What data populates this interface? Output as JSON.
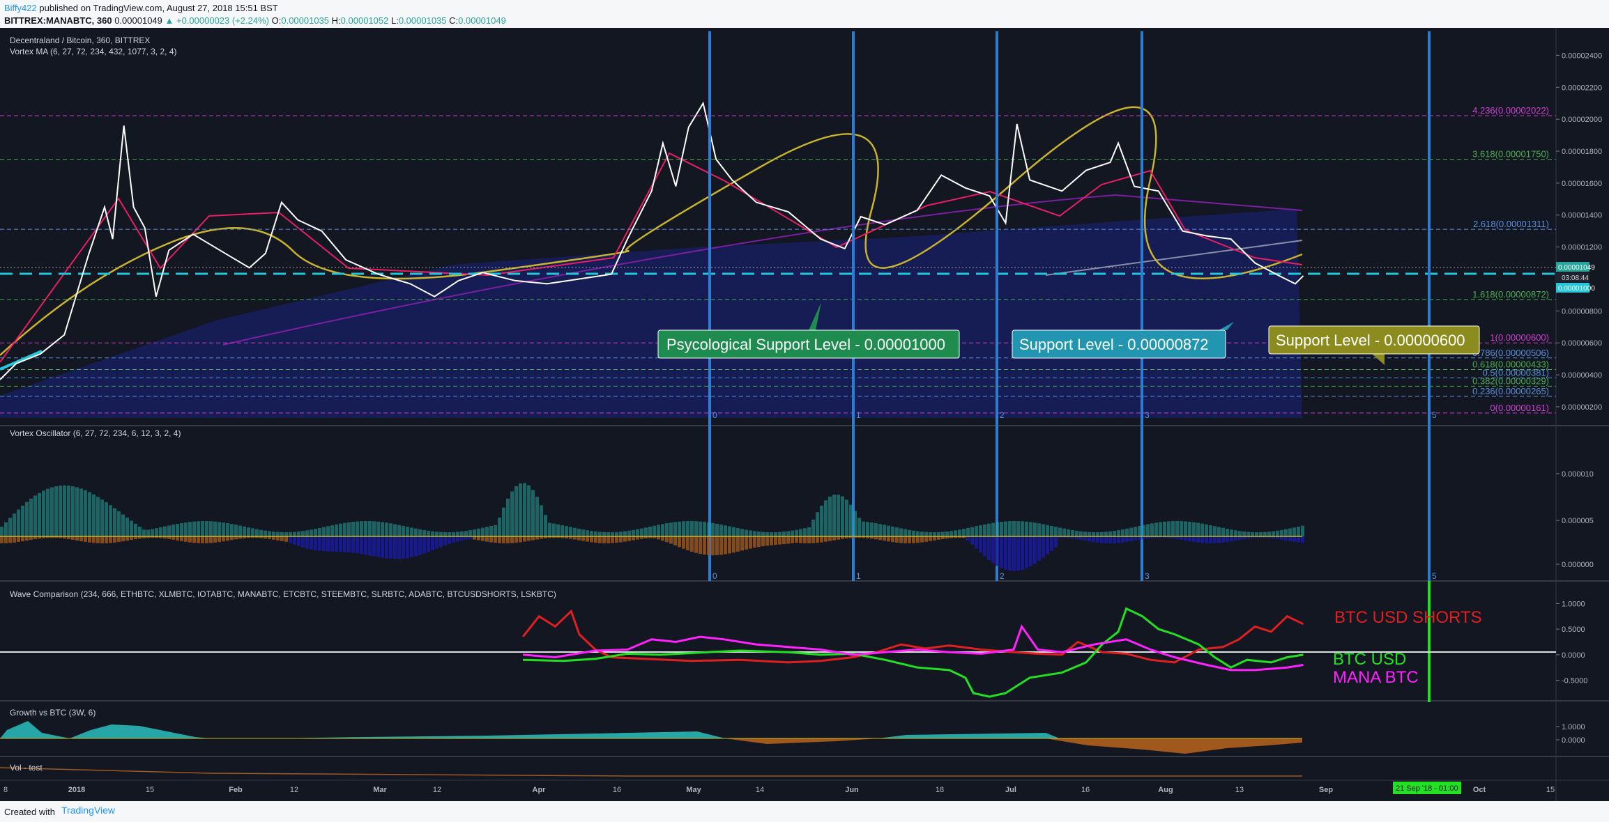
{
  "header": {
    "author": "Biffy422",
    "published": "published on TradingView.com, August 27, 2018 15:51 BST",
    "symbol": "BITTREX:MANABTC, 360",
    "last": "0.00001049",
    "change": "▲ +0.00000023 (+2.24%)",
    "o_label": "O:",
    "o": "0.00001035",
    "h_label": "H:",
    "h": "0.00001052",
    "l_label": "L:",
    "l": "0.00001035",
    "c_label": "C:",
    "c": "0.00001049"
  },
  "panes": {
    "main_title": "Decentraland / Bitcoin, 360, BITTREX",
    "main_indicator": "Vortex MA (6, 27, 72, 234, 432, 1077, 3, 2, 4)",
    "oscillator": "Vortex Oscillator (6, 27, 72, 234, 6, 12, 3, 2, 4)",
    "wave": "Wave Comparison (234, 666, ETHBTC, XLMBTC, IOTABTC, MANABTC, ETCBTC, STEEMBTC, SLRBTC, ADABTC, BTCUSDSHORTS, LSKBTC)",
    "growth": "Growth vs BTC (3W, 6)",
    "vol": "Vol - test"
  },
  "callouts": {
    "psych": "Psycological Support Level - 0.00001000",
    "support1": "Support Level - 0.00000872",
    "support2": "Support Level - 0.00000600"
  },
  "wave_labels": {
    "shorts": "BTC USD SHORTS",
    "btcusd": "BTC USD",
    "manabtc": "MANA BTC"
  },
  "price_badges": {
    "last": "0.00001049",
    "countdown": "03:08:44",
    "level": "0.00001000"
  },
  "date_badge": "21 Sep '18 - 01:00",
  "footer": {
    "created": "Created with",
    "brand": "TradingView"
  },
  "colors": {
    "background": "#131722",
    "price": "#ffffff",
    "ma_fast": "#e91e63",
    "ma_mid": "#c2185b",
    "ma_yellow": "#c9b42b",
    "ma_purple": "#7b1fa2",
    "cloud": "#1a237e",
    "vertical_lines": "#2e7bcf",
    "support_dash": "#26c6da",
    "shorts": "#e02020",
    "btcusd": "#22e022",
    "manabtc": "#ff22ff",
    "growth_up": "#26a6a6",
    "growth_down": "#a0581c"
  },
  "chart_data": [
    {
      "type": "line",
      "title": "Decentraland / Bitcoin, 360, BITTREX",
      "y_ticks": [
        "0.00002400",
        "0.00002200",
        "0.00002000",
        "0.00001800",
        "0.00001600",
        "0.00001400",
        "0.00001200",
        "0.00000800",
        "0.00000600",
        "0.00000400",
        "0.00000200"
      ],
      "ylim": [
        1.3e-06,
        2.55e-05
      ],
      "x_ticks": [
        "8",
        "2018",
        "15",
        "Feb",
        "12",
        "Mar",
        "12",
        "Apr",
        "16",
        "May",
        "14",
        "Jun",
        "18",
        "Jul",
        "16",
        "Aug",
        "13",
        "Sep",
        "Oct",
        "15"
      ],
      "fib_levels": [
        {
          "label": "4.236(0.00002022)",
          "value": 2.022e-05,
          "color": "#d040d0"
        },
        {
          "label": "3.618(0.00001750)",
          "value": 1.75e-05,
          "color": "#4caf50"
        },
        {
          "label": "2.618(0.00001311)",
          "value": 1.311e-05,
          "color": "#5b8fd9"
        },
        {
          "label": "1.618(0.00000872)",
          "value": 8.72e-06,
          "color": "#4caf50"
        },
        {
          "label": "1(0.00000600)",
          "value": 6e-06,
          "color": "#d040d0"
        },
        {
          "label": "0.786(0.00000506)",
          "value": 5.06e-06,
          "color": "#5b8fd9"
        },
        {
          "label": "0.618(0.00000433)",
          "value": 4.33e-06,
          "color": "#4caf50"
        },
        {
          "label": "0.5(0.00000381)",
          "value": 3.81e-06,
          "color": "#5b8fd9"
        },
        {
          "label": "0.382(0.00000329)",
          "value": 3.29e-06,
          "color": "#4caf50"
        },
        {
          "label": "0.236(0.00000265)",
          "value": 2.65e-06,
          "color": "#5b8fd9"
        },
        {
          "label": "0(0.00000161)",
          "value": 1.61e-06,
          "color": "#d040d0"
        }
      ],
      "support_level": 1e-05,
      "vertical_labels": [
        "0",
        "1",
        "2",
        "3",
        "5"
      ],
      "price_series": [
        [
          0,
          3.7e-06
        ],
        [
          0.01,
          4.7e-06
        ],
        [
          0.025,
          5.3e-06
        ],
        [
          0.04,
          6.5e-06
        ],
        [
          0.055,
          1.15e-05
        ],
        [
          0.065,
          1.45e-05
        ],
        [
          0.07,
          1.25e-05
        ],
        [
          0.077,
          1.96e-05
        ],
        [
          0.083,
          1.45e-05
        ],
        [
          0.09,
          1.32e-05
        ],
        [
          0.097,
          8.9e-06
        ],
        [
          0.105,
          1.18e-05
        ],
        [
          0.12,
          1.28e-05
        ],
        [
          0.14,
          1.16e-05
        ],
        [
          0.155,
          1.07e-05
        ],
        [
          0.165,
          1.16e-05
        ],
        [
          0.175,
          1.48e-05
        ],
        [
          0.185,
          1.37e-05
        ],
        [
          0.2,
          1.3e-05
        ],
        [
          0.215,
          1.12e-05
        ],
        [
          0.235,
          1.03e-05
        ],
        [
          0.255,
          9.7e-06
        ],
        [
          0.27,
          8.9e-06
        ],
        [
          0.285,
          9.9e-06
        ],
        [
          0.3,
          1.04e-05
        ],
        [
          0.32,
          9.9e-06
        ],
        [
          0.34,
          9.7e-06
        ],
        [
          0.36,
          1e-05
        ],
        [
          0.38,
          1.03e-05
        ],
        [
          0.39,
          1.25e-05
        ],
        [
          0.405,
          1.55e-05
        ],
        [
          0.412,
          1.85e-05
        ],
        [
          0.42,
          1.58e-05
        ],
        [
          0.428,
          1.95e-05
        ],
        [
          0.437,
          2.1e-05
        ],
        [
          0.445,
          1.75e-05
        ],
        [
          0.455,
          1.62e-05
        ],
        [
          0.47,
          1.48e-05
        ],
        [
          0.49,
          1.42e-05
        ],
        [
          0.51,
          1.25e-05
        ],
        [
          0.525,
          1.19e-05
        ],
        [
          0.535,
          1.39e-05
        ],
        [
          0.55,
          1.34e-05
        ],
        [
          0.57,
          1.43e-05
        ],
        [
          0.585,
          1.65e-05
        ],
        [
          0.6,
          1.57e-05
        ],
        [
          0.615,
          1.52e-05
        ],
        [
          0.625,
          1.35e-05
        ],
        [
          0.632,
          1.97e-05
        ],
        [
          0.64,
          1.62e-05
        ],
        [
          0.66,
          1.55e-05
        ],
        [
          0.675,
          1.68e-05
        ],
        [
          0.69,
          1.73e-05
        ],
        [
          0.695,
          1.85e-05
        ],
        [
          0.705,
          1.58e-05
        ],
        [
          0.72,
          1.55e-05
        ],
        [
          0.735,
          1.3e-05
        ],
        [
          0.75,
          1.27e-05
        ],
        [
          0.765,
          1.25e-05
        ],
        [
          0.78,
          1.1e-05
        ],
        [
          0.795,
          1.02e-05
        ],
        [
          0.805,
          9.7e-06
        ],
        [
          0.81,
          1.02e-05
        ]
      ]
    },
    {
      "type": "area",
      "title": "Vortex Oscillator (6, 27, 72, 234, 6, 12, 3, 2, 4)",
      "y_ticks": [
        "0.000010",
        "0.000005",
        "0.000000"
      ]
    },
    {
      "type": "line",
      "title": "Wave Comparison",
      "y_ticks": [
        "1.0000",
        "0.5000",
        "0.0000",
        "-0.5000"
      ],
      "ylim": [
        -0.9,
        1.1
      ],
      "series": [
        {
          "name": "BTC USD SHORTS",
          "color": "#e02020",
          "points": [
            [
              0.325,
              0.35
            ],
            [
              0.335,
              0.75
            ],
            [
              0.345,
              0.55
            ],
            [
              0.355,
              0.85
            ],
            [
              0.36,
              0.4
            ],
            [
              0.37,
              0.1
            ],
            [
              0.38,
              -0.05
            ],
            [
              0.4,
              -0.08
            ],
            [
              0.43,
              -0.12
            ],
            [
              0.46,
              -0.1
            ],
            [
              0.49,
              -0.15
            ],
            [
              0.51,
              -0.12
            ],
            [
              0.53,
              -0.05
            ],
            [
              0.545,
              0.05
            ],
            [
              0.56,
              0.2
            ],
            [
              0.575,
              0.12
            ],
            [
              0.59,
              0.18
            ],
            [
              0.61,
              0.1
            ],
            [
              0.63,
              0.05
            ],
            [
              0.645,
              0.02
            ],
            [
              0.66,
              0.0
            ],
            [
              0.67,
              0.25
            ],
            [
              0.685,
              0.05
            ],
            [
              0.7,
              0.02
            ],
            [
              0.715,
              -0.1
            ],
            [
              0.73,
              -0.15
            ],
            [
              0.745,
              0.1
            ],
            [
              0.76,
              0.15
            ],
            [
              0.77,
              0.3
            ],
            [
              0.78,
              0.55
            ],
            [
              0.79,
              0.45
            ],
            [
              0.8,
              0.75
            ],
            [
              0.81,
              0.6
            ]
          ]
        },
        {
          "name": "BTC USD",
          "color": "#22e022",
          "points": [
            [
              0.325,
              -0.1
            ],
            [
              0.35,
              -0.12
            ],
            [
              0.37,
              -0.08
            ],
            [
              0.39,
              0.02
            ],
            [
              0.41,
              0.0
            ],
            [
              0.44,
              0.05
            ],
            [
              0.46,
              0.08
            ],
            [
              0.49,
              0.05
            ],
            [
              0.51,
              0.0
            ],
            [
              0.53,
              0.02
            ],
            [
              0.55,
              -0.1
            ],
            [
              0.57,
              -0.25
            ],
            [
              0.59,
              -0.3
            ],
            [
              0.6,
              -0.45
            ],
            [
              0.605,
              -0.75
            ],
            [
              0.615,
              -0.82
            ],
            [
              0.625,
              -0.75
            ],
            [
              0.64,
              -0.45
            ],
            [
              0.66,
              -0.35
            ],
            [
              0.675,
              -0.15
            ],
            [
              0.685,
              0.2
            ],
            [
              0.695,
              0.45
            ],
            [
              0.7,
              0.9
            ],
            [
              0.71,
              0.75
            ],
            [
              0.72,
              0.5
            ],
            [
              0.73,
              0.4
            ],
            [
              0.745,
              0.2
            ],
            [
              0.755,
              -0.05
            ],
            [
              0.765,
              -0.25
            ],
            [
              0.775,
              -0.1
            ],
            [
              0.79,
              -0.15
            ],
            [
              0.8,
              -0.05
            ],
            [
              0.81,
              0.0
            ]
          ]
        },
        {
          "name": "MANA BTC",
          "color": "#ff22ff",
          "points": [
            [
              0.325,
              0.0
            ],
            [
              0.345,
              -0.05
            ],
            [
              0.37,
              0.08
            ],
            [
              0.39,
              0.1
            ],
            [
              0.405,
              0.3
            ],
            [
              0.42,
              0.25
            ],
            [
              0.435,
              0.35
            ],
            [
              0.45,
              0.3
            ],
            [
              0.47,
              0.2
            ],
            [
              0.49,
              0.15
            ],
            [
              0.51,
              0.1
            ],
            [
              0.53,
              0.0
            ],
            [
              0.55,
              0.05
            ],
            [
              0.57,
              0.1
            ],
            [
              0.59,
              0.05
            ],
            [
              0.61,
              0.02
            ],
            [
              0.63,
              0.1
            ],
            [
              0.635,
              0.55
            ],
            [
              0.645,
              0.1
            ],
            [
              0.66,
              0.05
            ],
            [
              0.68,
              0.2
            ],
            [
              0.7,
              0.3
            ],
            [
              0.715,
              0.1
            ],
            [
              0.73,
              -0.05
            ],
            [
              0.75,
              -0.2
            ],
            [
              0.765,
              -0.3
            ],
            [
              0.78,
              -0.3
            ],
            [
              0.8,
              -0.25
            ],
            [
              0.81,
              -0.2
            ]
          ]
        }
      ]
    },
    {
      "type": "area",
      "title": "Growth vs BTC (3W, 6)",
      "y_ticks": [
        "1.0000",
        "0.0000"
      ]
    }
  ]
}
